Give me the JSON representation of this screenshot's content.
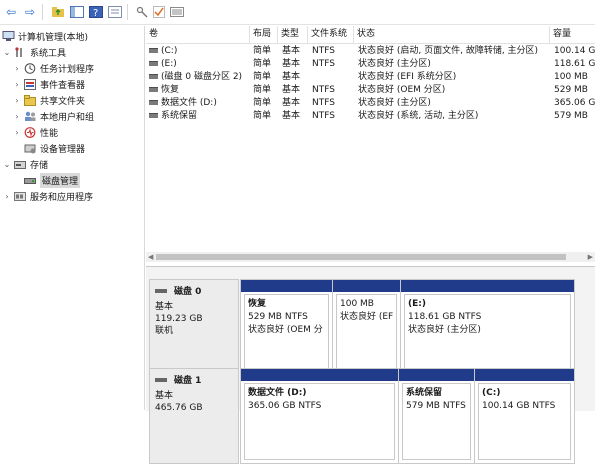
{
  "toolbar": {
    "icons": [
      "back-arrow-icon",
      "forward-arrow-icon",
      "up-folder-icon",
      "console-tree-icon",
      "help-icon",
      "properties-icon",
      "key-icon",
      "check-icon",
      "list-view-icon"
    ]
  },
  "tree": {
    "root": "计算机管理(本地)",
    "items": [
      {
        "label": "系统工具"
      },
      {
        "label": "任务计划程序"
      },
      {
        "label": "事件查看器"
      },
      {
        "label": "共享文件夹"
      },
      {
        "label": "本地用户和组"
      },
      {
        "label": "性能"
      },
      {
        "label": "设备管理器"
      },
      {
        "label": "存储"
      },
      {
        "label": "磁盘管理"
      },
      {
        "label": "服务和应用程序"
      }
    ]
  },
  "volumes": {
    "columns": [
      "卷",
      "布局",
      "类型",
      "文件系统",
      "状态",
      "容量"
    ],
    "rows": [
      {
        "vol": "(C:)",
        "layout": "简单",
        "type": "基本",
        "fs": "NTFS",
        "status": "状态良好 (启动, 页面文件, 故障转储, 主分区)",
        "cap": "100.14 G"
      },
      {
        "vol": "(E:)",
        "layout": "简单",
        "type": "基本",
        "fs": "NTFS",
        "status": "状态良好 (主分区)",
        "cap": "118.61 G"
      },
      {
        "vol": "(磁盘 0 磁盘分区 2)",
        "layout": "简单",
        "type": "基本",
        "fs": "",
        "status": "状态良好 (EFI 系统分区)",
        "cap": "100 MB"
      },
      {
        "vol": "恢复",
        "layout": "简单",
        "type": "基本",
        "fs": "NTFS",
        "status": "状态良好 (OEM 分区)",
        "cap": "529 MB"
      },
      {
        "vol": "数据文件 (D:)",
        "layout": "简单",
        "type": "基本",
        "fs": "NTFS",
        "status": "状态良好 (主分区)",
        "cap": "365.06 G"
      },
      {
        "vol": "系统保留",
        "layout": "简单",
        "type": "基本",
        "fs": "NTFS",
        "status": "状态良好 (系统, 活动, 主分区)",
        "cap": "579 MB"
      }
    ]
  },
  "disk0": {
    "name": "磁盘 0",
    "kind": "基本",
    "size": "119.23 GB",
    "state": "联机",
    "parts": [
      {
        "title": "恢复",
        "size": "529 MB NTFS",
        "status": "状态良好 (OEM 分"
      },
      {
        "title": "",
        "size": "100 MB",
        "status": "状态良好 (EF"
      },
      {
        "title": "(E:)",
        "size": "118.61 GB NTFS",
        "status": "状态良好 (主分区)"
      }
    ]
  },
  "disk1": {
    "name": "磁盘 1",
    "kind": "基本",
    "size": "465.76 GB",
    "parts": [
      {
        "title": "数据文件 (D:)",
        "size": "365.06 GB NTFS"
      },
      {
        "title": "系统保留",
        "size": "579 MB NTFS"
      },
      {
        "title": "(C:)",
        "size": "100.14 GB NTFS"
      }
    ]
  },
  "colors": {
    "partition_bar": "#1f3b8a",
    "selection": "#d9d9d9"
  }
}
